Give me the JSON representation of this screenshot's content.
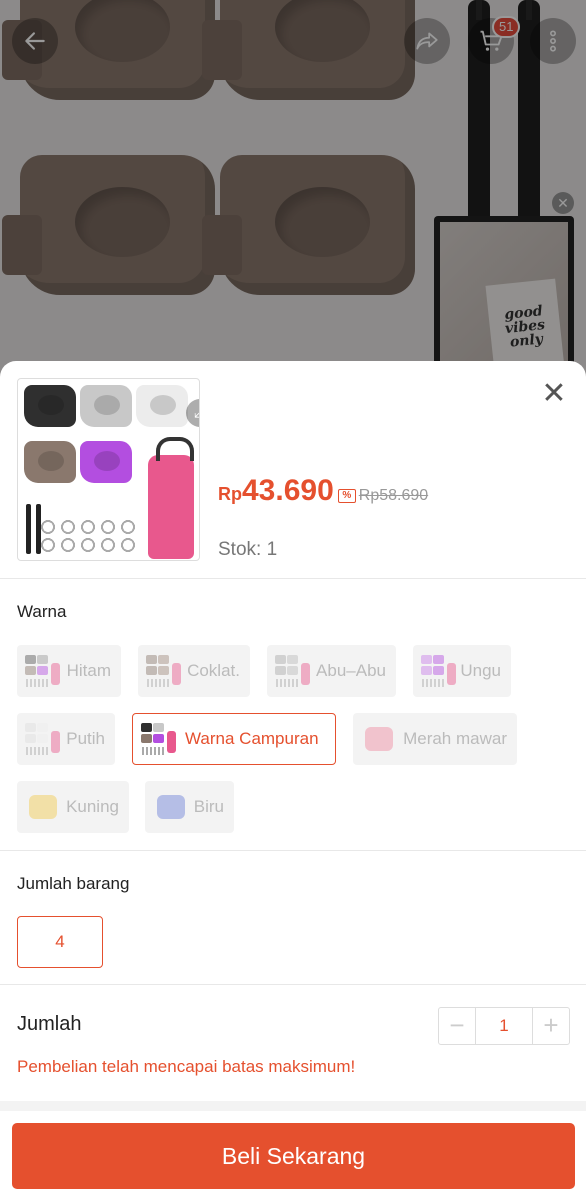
{
  "header": {
    "cart_count": "51",
    "icons": [
      "back-arrow-icon",
      "share-icon",
      "cart-icon",
      "more-vertical-icon"
    ]
  },
  "video_overlay": {
    "card_text": "good vibes only"
  },
  "product": {
    "price_currency": "Rp",
    "price_value": "43.690",
    "original_price": "Rp58.690",
    "stock": "Stok: 1"
  },
  "variants": {
    "title": "Warna",
    "options": [
      {
        "label": "Hitam",
        "state": "disabled"
      },
      {
        "label": "Coklat.",
        "state": "disabled"
      },
      {
        "label": "Abu–Abu",
        "state": "disabled"
      },
      {
        "label": "Ungu",
        "state": "disabled"
      },
      {
        "label": "Putih",
        "state": "disabled"
      },
      {
        "label": "Warna Campuran",
        "state": "selected"
      },
      {
        "label": "Merah mawar",
        "state": "disabled"
      },
      {
        "label": "Kuning",
        "state": "disabled"
      },
      {
        "label": "Biru",
        "state": "disabled"
      }
    ]
  },
  "item_count": {
    "title": "Jumlah barang",
    "options": [
      {
        "label": "4",
        "state": "selected"
      }
    ]
  },
  "quantity": {
    "label": "Jumlah",
    "value": "1",
    "decrement": "−",
    "increment": "+",
    "limit_message": "Pembelian telah mencapai batas maksimum!"
  },
  "colors": {
    "accent": "#e5502e",
    "disabled_bg": "#f3f3f3"
  },
  "buy_button": "Beli Sekarang"
}
